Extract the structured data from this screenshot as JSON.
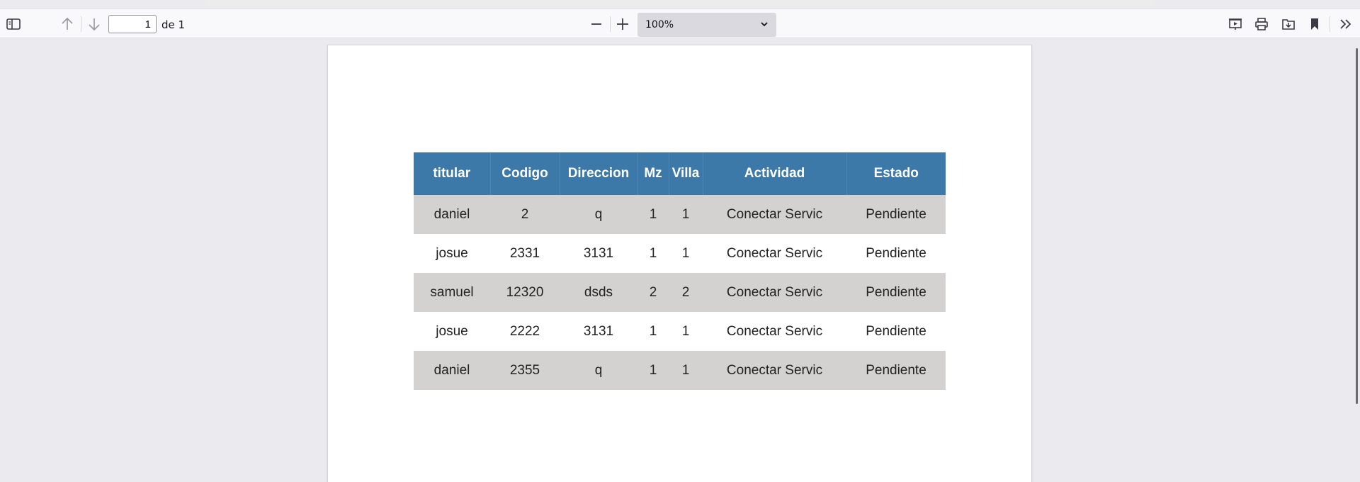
{
  "toolbar": {
    "page_number": "1",
    "page_of": "de 1",
    "zoom": "100%"
  },
  "icons": [
    "sidebar-toggle-icon",
    "arrow-up-icon",
    "arrow-down-icon",
    "minus-icon",
    "plus-icon",
    "chevron-down-icon",
    "presentation-icon",
    "print-icon",
    "save-icon",
    "bookmark-icon",
    "double-chevron-right-icon"
  ],
  "table": {
    "headers": [
      "titular",
      "Codigo",
      "Direccion",
      "Mz",
      "Villa",
      "Actividad",
      "Estado"
    ],
    "rows": [
      [
        "daniel",
        "2",
        "q",
        "1",
        "1",
        "Conectar Servic",
        "Pendiente"
      ],
      [
        "josue",
        "2331",
        "3131",
        "1",
        "1",
        "Conectar Servic",
        "Pendiente"
      ],
      [
        "samuel",
        "12320",
        "dsds",
        "2",
        "2",
        "Conectar Servic",
        "Pendiente"
      ],
      [
        "josue",
        "2222",
        "3131",
        "1",
        "1",
        "Conectar Servic",
        "Pendiente"
      ],
      [
        "daniel",
        "2355",
        "q",
        "1",
        "1",
        "Conectar Servic",
        "Pendiente"
      ]
    ]
  },
  "colors": {
    "header_bg": "#3c78a8",
    "odd_row_bg": "#d3d2d1",
    "viewer_bg": "#ebebef"
  }
}
